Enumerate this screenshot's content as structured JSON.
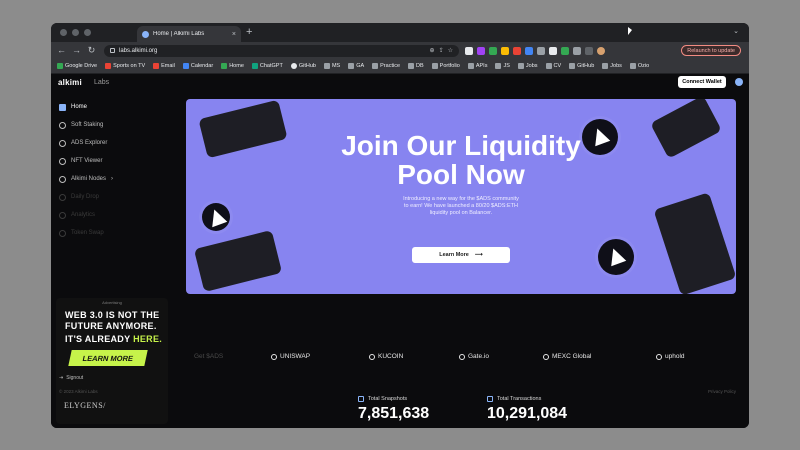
{
  "browser": {
    "tab_title": "Home | Alkimi Labs",
    "url": "labs.alkimi.org",
    "relaunch_label": "Relaunch to update",
    "bookmarks": [
      "Google Drive",
      "Sports on TV",
      "Email",
      "Calendar",
      "Home",
      "ChatGPT",
      "GitHub",
      "MS",
      "GA",
      "Practice",
      "DB",
      "Portfolio",
      "APIs",
      "JS",
      "Jobs",
      "CV",
      "GitHub",
      "Jobs",
      "Ozio"
    ]
  },
  "header": {
    "logo": "alkimi",
    "sub": "Labs",
    "connect_label": "Connect Wallet"
  },
  "sidebar": {
    "items": [
      {
        "label": "Home"
      },
      {
        "label": "Soft Staking"
      },
      {
        "label": "ADS Explorer"
      },
      {
        "label": "NFT Viewer"
      },
      {
        "label": "Alkimi Nodes"
      },
      {
        "label": "Daily Drop"
      },
      {
        "label": "Analytics"
      },
      {
        "label": "Token Swap"
      }
    ],
    "signout_label": "Signout"
  },
  "banner": {
    "title_line1": "Join Our Liquidity",
    "title_line2": "Pool Now",
    "subtitle_line1": "Introducing a new way for the $ADS community",
    "subtitle_line2": "to earn! We have launched a 80/20 $ADS:ETH",
    "subtitle_line3": "liquidity pool on Balancer.",
    "button_label": "Learn More",
    "button_arrow": "⟶"
  },
  "ad": {
    "label": "Advertising",
    "line1a": "WEB 3.0 IS NOT THE",
    "line1b": "FUTURE ANYMORE.",
    "line2a": "IT'S ALREADY",
    "line2b": "HERE.",
    "button_label": "LEARN MORE",
    "brand": "ELYGENS/"
  },
  "exchanges": {
    "get_label": "Get $ADS",
    "items": [
      "UNISWAP",
      "KUCOIN",
      "Gate.io",
      "MEXC Global",
      "uphold"
    ]
  },
  "stats": {
    "snapshots_label": "Total Snapshots",
    "snapshots_value": "7,851,638",
    "transactions_label": "Total Transactions",
    "transactions_value": "10,291,084"
  },
  "footer": {
    "copyright": "© 2023 Alkimi Labs",
    "privacy": "Privacy Policy"
  },
  "colors": {
    "banner": "#8784f0",
    "accent_green": "#c6f34a",
    "page_bg": "#0b0b0d"
  }
}
